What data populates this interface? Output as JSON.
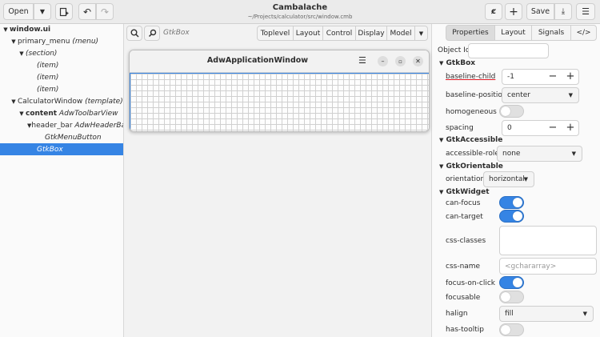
{
  "header": {
    "open_label": "Open",
    "title": "Cambalache",
    "subtitle": "~/Projects/calculator/src/window.cmb",
    "save_label": "Save"
  },
  "tree": [
    {
      "name": "window.ui",
      "type": ""
    },
    {
      "name": "primary_menu",
      "type": "(menu)"
    },
    {
      "name": "",
      "type": "(section)"
    },
    {
      "name": "",
      "type": "(item)"
    },
    {
      "name": "",
      "type": "(item)"
    },
    {
      "name": "",
      "type": "(item)"
    },
    {
      "name": "CalculatorWindow",
      "type": "(template)"
    },
    {
      "name": "content",
      "type": "AdwToolbarView"
    },
    {
      "name": "header_bar",
      "type": "AdwHeaderBar"
    },
    {
      "name": "",
      "type": "GtkMenuButton"
    },
    {
      "name": "",
      "type": "GtkBox"
    }
  ],
  "workspace": {
    "search_value": "GtkBox",
    "toolbar": [
      "Toplevel",
      "Layout",
      "Control",
      "Display",
      "Model"
    ],
    "window_title": "AdwApplicationWindow"
  },
  "props_tabs": [
    "Properties",
    "Layout",
    "Signals",
    "</>"
  ],
  "props": {
    "object_id_label": "Object Id",
    "sections": {
      "gtkbox": "GtkBox",
      "gtkaccessible": "GtkAccessible",
      "gtkorientable": "GtkOrientable",
      "gtkwidget": "GtkWidget"
    },
    "baseline_child": {
      "label": "baseline-child",
      "value": "-1"
    },
    "baseline_position": {
      "label": "baseline-position",
      "value": "center"
    },
    "homogeneous": {
      "label": "homogeneous",
      "on": false
    },
    "spacing": {
      "label": "spacing",
      "value": "0"
    },
    "accessible_role": {
      "label": "accessible-role",
      "value": "none"
    },
    "orientation": {
      "label": "orientation",
      "value": "horizontal"
    },
    "can_focus": {
      "label": "can-focus",
      "on": true
    },
    "can_target": {
      "label": "can-target",
      "on": true
    },
    "css_classes": {
      "label": "css-classes"
    },
    "css_name": {
      "label": "css-name",
      "placeholder": "<gchararray>"
    },
    "focus_on_click": {
      "label": "focus-on-click",
      "on": true
    },
    "focusable": {
      "label": "focusable",
      "on": false
    },
    "halign": {
      "label": "halign",
      "value": "fill"
    },
    "has_tooltip": {
      "label": "has-tooltip",
      "on": false
    }
  },
  "colors": {
    "accent": "#3584e4",
    "selected_text": "#ffffff"
  }
}
